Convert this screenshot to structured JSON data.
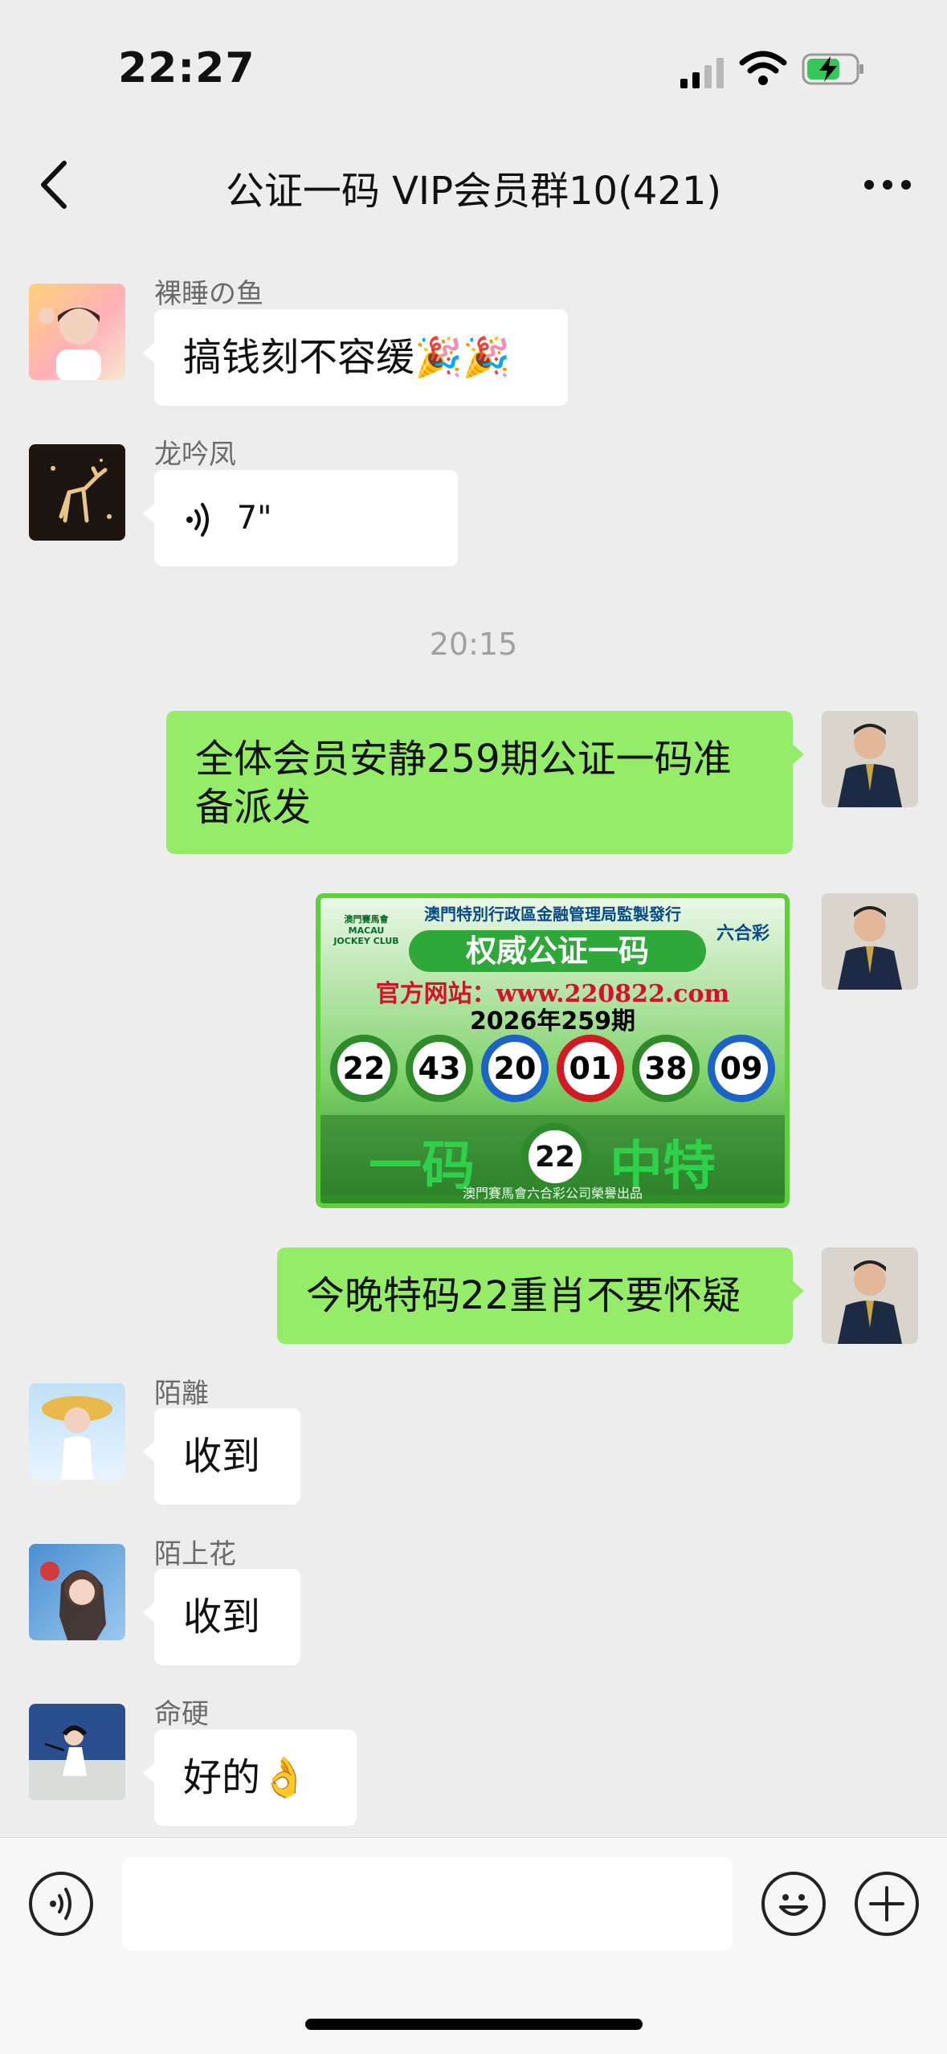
{
  "status": {
    "time": "22:27"
  },
  "header": {
    "title": "公证一码 VIP会员群10(421)"
  },
  "messages": [
    {
      "sender": "裸睡の鱼",
      "text": "搞钱刻不容缓🎉🎉"
    },
    {
      "sender": "龙吟凤",
      "voice_duration": "7\""
    },
    {
      "timestamp": "20:15"
    },
    {
      "text": "全体会员安静259期公证一码准备派发"
    },
    {
      "text": "今晚特码22重肖不要怀疑"
    },
    {
      "sender": "陌離",
      "text": "收到"
    },
    {
      "sender": "陌上花",
      "text": "收到"
    },
    {
      "sender": "命硬",
      "text": "好的👌"
    }
  ],
  "lottery_image": {
    "header": "澳門特別行政區金融管理局監製發行",
    "title": "权威公证一码",
    "site": "官方网站：www.220822.com",
    "period": "2026年259期",
    "balls": [
      {
        "num": "22",
        "color": "green"
      },
      {
        "num": "43",
        "color": "green"
      },
      {
        "num": "20",
        "color": "blue"
      },
      {
        "num": "01",
        "color": "red"
      },
      {
        "num": "38",
        "color": "green"
      },
      {
        "num": "09",
        "color": "blue"
      }
    ],
    "left_text": "一码",
    "special": "22",
    "right_text": "中特",
    "footer": "澳門賽馬會六合彩公司榮譽出品",
    "logo_left": "澳門賽馬會 MACAU JOCKEY CLUB",
    "logo_right": "六合彩"
  },
  "colors": {
    "outgoing": "#95EC69",
    "incoming": "#FFFFFF",
    "background": "#EDEDED"
  }
}
